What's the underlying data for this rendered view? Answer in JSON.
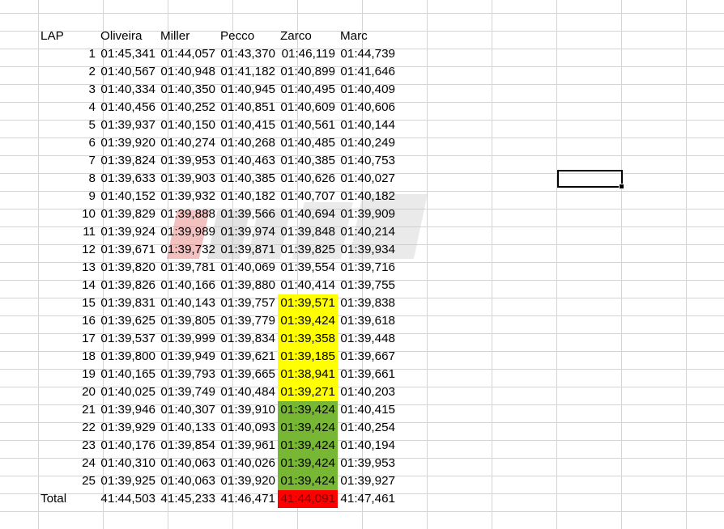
{
  "columns": [
    "LAP",
    "Oliveira",
    "Miller",
    "Pecco",
    "Zarco",
    "Marc"
  ],
  "rows": [
    [
      "1",
      "01:45,341",
      "01:44,057",
      "01:43,370",
      "01:46,119",
      "01:44,739"
    ],
    [
      "2",
      "01:40,567",
      "01:40,948",
      "01:41,182",
      "01:40,899",
      "01:41,646"
    ],
    [
      "3",
      "01:40,334",
      "01:40,350",
      "01:40,945",
      "01:40,495",
      "01:40,409"
    ],
    [
      "4",
      "01:40,456",
      "01:40,252",
      "01:40,851",
      "01:40,609",
      "01:40,606"
    ],
    [
      "5",
      "01:39,937",
      "01:40,150",
      "01:40,415",
      "01:40,561",
      "01:40,144"
    ],
    [
      "6",
      "01:39,920",
      "01:40,274",
      "01:40,268",
      "01:40,485",
      "01:40,249"
    ],
    [
      "7",
      "01:39,824",
      "01:39,953",
      "01:40,463",
      "01:40,385",
      "01:40,753"
    ],
    [
      "8",
      "01:39,633",
      "01:39,903",
      "01:40,385",
      "01:40,626",
      "01:40,027"
    ],
    [
      "9",
      "01:40,152",
      "01:39,932",
      "01:40,182",
      "01:40,707",
      "01:40,182"
    ],
    [
      "10",
      "01:39,829",
      "01:39,888",
      "01:39,566",
      "01:40,694",
      "01:39,909"
    ],
    [
      "11",
      "01:39,924",
      "01:39,989",
      "01:39,974",
      "01:39,848",
      "01:40,214"
    ],
    [
      "12",
      "01:39,671",
      "01:39,732",
      "01:39,871",
      "01:39,825",
      "01:39,934"
    ],
    [
      "13",
      "01:39,820",
      "01:39,781",
      "01:40,069",
      "01:39,554",
      "01:39,716"
    ],
    [
      "14",
      "01:39,826",
      "01:40,166",
      "01:39,880",
      "01:40,414",
      "01:39,755"
    ],
    [
      "15",
      "01:39,831",
      "01:40,143",
      "01:39,757",
      "01:39,571",
      "01:39,838"
    ],
    [
      "16",
      "01:39,625",
      "01:39,805",
      "01:39,779",
      "01:39,424",
      "01:39,618"
    ],
    [
      "17",
      "01:39,537",
      "01:39,999",
      "01:39,834",
      "01:39,358",
      "01:39,448"
    ],
    [
      "18",
      "01:39,800",
      "01:39,949",
      "01:39,621",
      "01:39,185",
      "01:39,667"
    ],
    [
      "19",
      "01:40,165",
      "01:39,793",
      "01:39,665",
      "01:38,941",
      "01:39,661"
    ],
    [
      "20",
      "01:40,025",
      "01:39,749",
      "01:40,484",
      "01:39,271",
      "01:40,203"
    ],
    [
      "21",
      "01:39,946",
      "01:40,307",
      "01:39,910",
      "01:39,424",
      "01:40,415"
    ],
    [
      "22",
      "01:39,929",
      "01:40,133",
      "01:40,093",
      "01:39,424",
      "01:40,254"
    ],
    [
      "23",
      "01:40,176",
      "01:39,854",
      "01:39,961",
      "01:39,424",
      "01:40,194"
    ],
    [
      "24",
      "01:40,310",
      "01:40,063",
      "01:40,026",
      "01:39,424",
      "01:39,953"
    ],
    [
      "25",
      "01:39,925",
      "01:40,063",
      "01:39,920",
      "01:39,424",
      "01:39,927"
    ]
  ],
  "total": [
    "Total",
    "41:44,503",
    "41:45,233",
    "41:46,471",
    "41:44,091",
    "41:47,461"
  ],
  "highlights": {
    "yellow_rows": [
      15,
      16,
      17,
      18,
      19,
      20
    ],
    "green_rows": [
      21,
      22,
      23,
      24,
      25
    ],
    "highlight_column": "Zarco",
    "total_highlight_column": "Zarco",
    "colors": {
      "yellow": "#ffff00",
      "green": "#77b734",
      "red": "#ff0000"
    }
  }
}
